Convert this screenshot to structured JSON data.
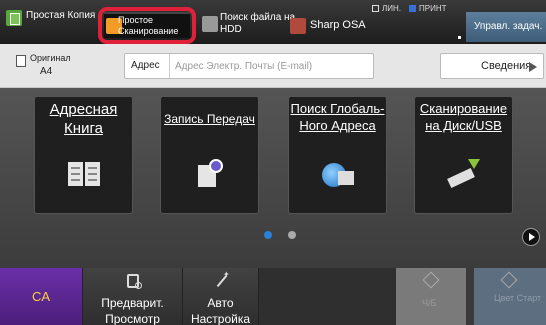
{
  "top_tabs": [
    {
      "label": "Простая Копия"
    },
    {
      "label": "Простое Сканирование"
    },
    {
      "label": "Поиск файла на HDD"
    },
    {
      "label": "Sharp OSA"
    }
  ],
  "status": {
    "line_label": "ЛИН.",
    "print_label": "ПРИНТ"
  },
  "job_status_button": {
    "label": "Управл. задач."
  },
  "original": {
    "label": "Оригинал",
    "size": "A4"
  },
  "address": {
    "label": "Адрес",
    "value": "",
    "placeholder": "Адрес Электр. Почты (E-mail)"
  },
  "details_button": {
    "label": "Сведения"
  },
  "tiles": [
    {
      "title": "Адресная Книга",
      "icon": "address-book-icon"
    },
    {
      "title": "Запись Передач",
      "icon": "sending-history-icon"
    },
    {
      "title": "Поиск Глобаль-Ного Адреса",
      "icon": "global-address-icon"
    },
    {
      "title": "Сканирование на Диск/USB",
      "icon": "usb-drive-icon"
    }
  ],
  "pager": {
    "current": 1,
    "total": 2
  },
  "bottom": {
    "ca_label": "CA",
    "preview_label": "Предварит. Просмотр",
    "auto_label": "Авто Настройка",
    "bw_start_label": "Ч/Б",
    "color_start_label": "Цвет Старт"
  },
  "colors": {
    "highlight": "#e0213a",
    "ca_button": "#5a248f",
    "ca_text": "#ffd23c",
    "active_page_dot": "#2a7fd6",
    "job_button": "#4d6e8c"
  }
}
